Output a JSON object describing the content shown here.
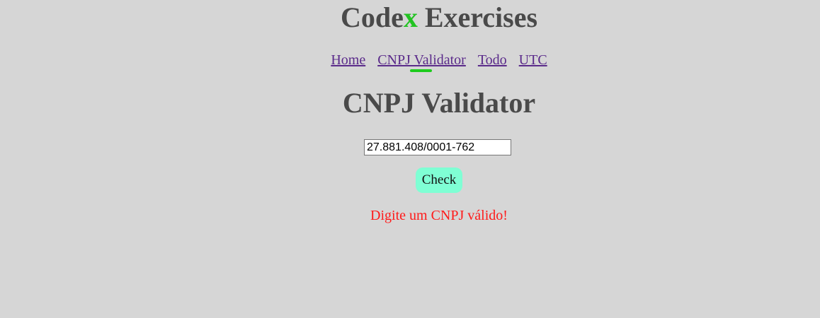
{
  "header": {
    "title_prefix": "Code",
    "title_accent": "x",
    "title_suffix": " Exercises",
    "accent_color": "#22c322"
  },
  "nav": {
    "items": [
      {
        "label": "Home",
        "active": false
      },
      {
        "label": "CNPJ Validator",
        "active": true
      },
      {
        "label": "Todo",
        "active": false
      },
      {
        "label": "UTC",
        "active": false
      }
    ],
    "active_indicator_color": "#1ecb1e"
  },
  "main": {
    "title": "CNPJ Validator",
    "input_value": "27.881.408/0001-762",
    "check_label": "Check",
    "check_color": "#7fffd4",
    "error_text": "Digite um CNPJ válido!",
    "error_color": "#ff1a1a"
  }
}
